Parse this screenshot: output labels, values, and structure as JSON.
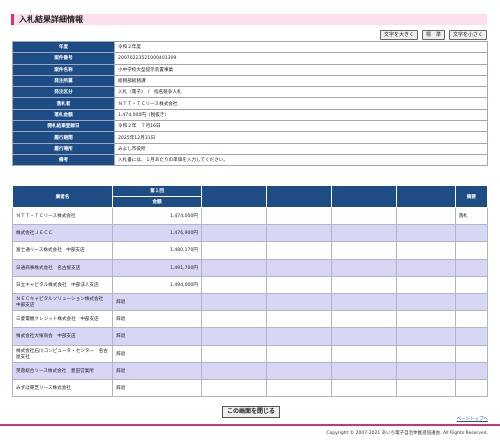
{
  "page_title": "入札結果詳細情報",
  "font_buttons": [
    "文字を大きく",
    "標　準",
    "文字を小さく"
  ],
  "detail_rows": [
    {
      "label": "年度",
      "value": "令和２年度"
    },
    {
      "label": "案件番号",
      "value": "20070223521000401309"
    },
    {
      "label": "案件名称",
      "value": "小中学校大型提示装置事業"
    },
    {
      "label": "発注所属",
      "value": "総務部総務課"
    },
    {
      "label": "発注区分",
      "value": "入札（電子）　/　指名競争入札"
    },
    {
      "label": "落札者",
      "value": "ＮＴＴ・ＴＣリース株式会社"
    },
    {
      "label": "落札金額",
      "value": "1,474,000円（税抜き）"
    },
    {
      "label": "開札結果登録日",
      "value": "令和２年　７月16日"
    },
    {
      "label": "履行期間",
      "value": "2025年12月31日"
    },
    {
      "label": "履行場所",
      "value": "みよし市役所"
    },
    {
      "label": "備考",
      "value": "入札書には、１月あたりの単価を入力してください。"
    }
  ],
  "results": {
    "header_bidder": "業者名",
    "header_round": "第１回",
    "header_amount": "金額",
    "header_note": "摘要",
    "rows": [
      {
        "name": "ＮＴＴ・ＴＣリース株式会社",
        "amount": "1,474,000円",
        "note": "落札"
      },
      {
        "name": "株式会社ＪＥＣＣ　　",
        "amount": "1,476,900円",
        "note": ""
      },
      {
        "name": "富士通リース株式会社　中部支店",
        "amount": "1,480,170円",
        "note": ""
      },
      {
        "name": "日通商事株式会社　名古屋支店",
        "amount": "1,491,700円",
        "note": ""
      },
      {
        "name": "日立キャピタル株式会社　中部法人支店",
        "amount": "1,494,000円",
        "note": ""
      },
      {
        "name": "ＮＥＣキャピタルソリューション株式会社　中部支店",
        "amount": "辞退",
        "note": ""
      },
      {
        "name": "三菱電機クレジット株式会社　中部支店",
        "amount": "辞退",
        "note": ""
      },
      {
        "name": "株式会社大塚商会　中部支店",
        "amount": "辞退",
        "note": ""
      },
      {
        "name": "株式会社石川コンピュータ・センター　名古屋支社",
        "amount": "辞退",
        "note": ""
      },
      {
        "name": "芙蓉総合リース株式会社　豊田営業所",
        "amount": "辞退",
        "note": ""
      },
      {
        "name": "みずほ東芝リース株式会社",
        "amount": "辞退",
        "note": ""
      }
    ]
  },
  "close_button": "この画面を閉じる",
  "page_top_link": "ページトップへ",
  "copyright": "Copyright © 2007-2021 あいち電子自治体推進協議会. All Rights Reserved."
}
